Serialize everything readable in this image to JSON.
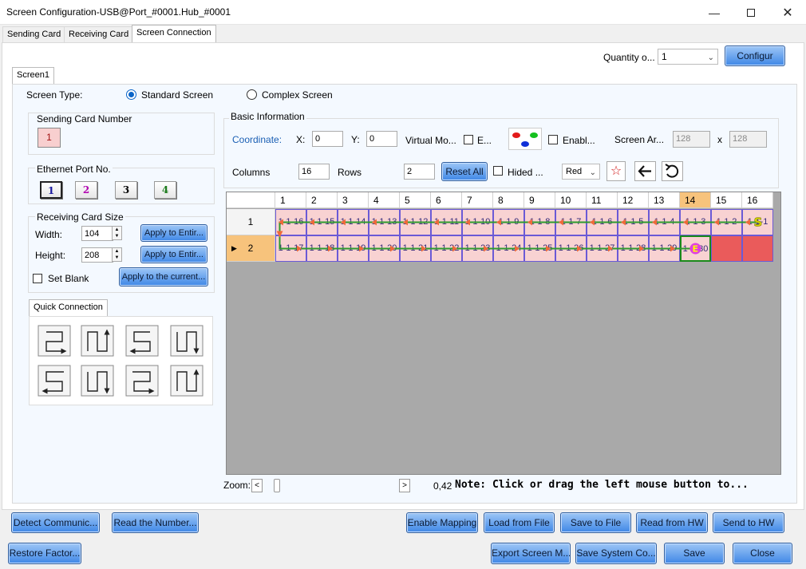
{
  "window": {
    "title": "Screen Configuration-USB@Port_#0001.Hub_#0001"
  },
  "tabs": [
    "Sending Card",
    "Receiving Card",
    "Screen Connection"
  ],
  "top": {
    "quantity_label": "Quantity o...",
    "quantity_value": "1",
    "config_button": "Configur"
  },
  "screen_tab": "Screen1",
  "screen_type": {
    "label": "Screen Type:",
    "standard": "Standard Screen",
    "complex": "Complex Screen"
  },
  "sending_card": {
    "title": "Sending Card Number",
    "value": "1"
  },
  "ethernet": {
    "title": "Ethernet Port No.",
    "ports": [
      "1",
      "2",
      "3",
      "4"
    ],
    "port_colors": [
      "#1a1aa0",
      "#b000b0",
      "#000000",
      "#1a7a1a"
    ]
  },
  "receiving_size": {
    "title": "Receiving Card Size",
    "width_label": "Width:",
    "width_value": "104",
    "height_label": "Height:",
    "height_value": "208",
    "apply_entire": "Apply to Entir...",
    "set_blank": "Set Blank",
    "apply_current": "Apply to the current..."
  },
  "quick_connection": {
    "title": "Quick Connection"
  },
  "basic_info": {
    "title": "Basic Information",
    "coordinate_label": "Coordinate:",
    "x_label": "X:",
    "x_value": "0",
    "y_label": "Y:",
    "y_value": "0",
    "virtual_mode": "Virtual Mo...",
    "e_label": "E...",
    "enable_label": "Enabl...",
    "screen_area_label": "Screen Ar...",
    "area_w": "128",
    "area_x": "x",
    "area_h": "128",
    "columns_label": "Columns",
    "columns_value": "16",
    "rows_label": "Rows",
    "rows_value": "2",
    "reset_all": "Reset All",
    "hided_label": "Hided ...",
    "color_value": "Red"
  },
  "grid": {
    "columns": [
      "1",
      "2",
      "3",
      "4",
      "5",
      "6",
      "7",
      "8",
      "9",
      "10",
      "11",
      "12",
      "13",
      "14",
      "15",
      "16"
    ],
    "selected_column": 14,
    "rows": [
      "1",
      "2"
    ],
    "selected_row": 2,
    "row1": [
      "1-1-16",
      "1-1-15",
      "1-1-14",
      "1-1-13",
      "1-1-12",
      "1-1-11",
      "1-1-10",
      "1-1-9",
      "1-1-8",
      "1-1-7",
      "1-1-6",
      "1-1-5",
      "1-1-4",
      "1-1-3",
      "1-1-2",
      "1-1-1"
    ],
    "row2": [
      "1-1-17",
      "1-1-18",
      "1-1-19",
      "1-1-20",
      "1-1-21",
      "1-1-22",
      "1-1-23",
      "1-1-24",
      "1-1-25",
      "1-1-26",
      "1-1-27",
      "1-1-28",
      "1-1-29",
      "1-1-30",
      "",
      ""
    ],
    "start_marker": "S",
    "end_marker": "E"
  },
  "zoom": {
    "label": "Zoom:",
    "left": "<",
    "right": ">",
    "value": "0,42",
    "note": "Note: Click or drag the left mouse button to..."
  },
  "buttons_row1": {
    "detect": "Detect Communic...",
    "read_number": "Read the Number...",
    "enable_mapping": "Enable Mapping",
    "load_file": "Load from File",
    "save_file": "Save to File",
    "read_hw": "Read from HW",
    "send_hw": "Send to HW"
  },
  "buttons_row2": {
    "restore": "Restore Factor...",
    "export": "Export Screen M...",
    "save_system": "Save System Co...",
    "save": "Save",
    "close": "Close"
  }
}
